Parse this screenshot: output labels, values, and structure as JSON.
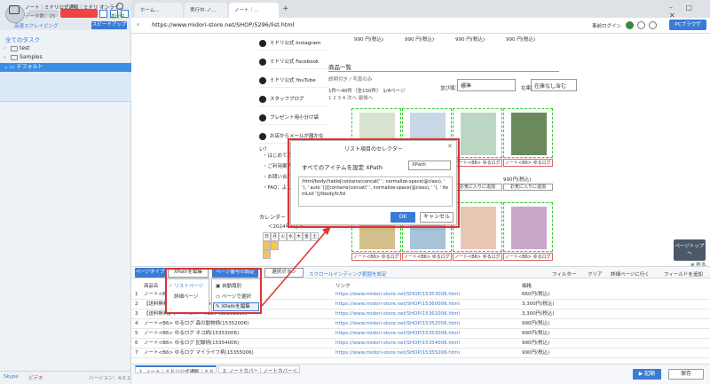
{
  "left": {
    "all_tasks": "全てのタスク",
    "tree": [
      "test",
      "Samples"
    ],
    "default_folder": "デフォルト",
    "task": {
      "title": "ノート｜ミドリ公式通販｜ミドリ オンライ...",
      "data": "データ数：25",
      "status": "運行中",
      "sub": "高速スクレイピング",
      "speedup": "スピードアップ"
    },
    "footer": {
      "skype": "Skype",
      "video": "ビデオ",
      "version": "バージョン：4.0.2"
    }
  },
  "browser": {
    "tabs": [
      "ホーム...",
      "実行中-ノ...",
      "ノート｜..."
    ],
    "tab_add": "+",
    "url": "https://www.midori-store.net/SHOP/5296/list.html",
    "login": "事前ログイン",
    "pc_browser": "PCブラウザ"
  },
  "page": {
    "prices_top": [
      "990 円(税込)",
      "990 円(税込)",
      "990 円(税込)",
      "990 円(税込)"
    ],
    "sidebar_links": [
      "ミドリ公式 Instagram",
      "ミドリ公式 Facebook",
      "ミドリ公式 YouTube",
      "スタッフブログ",
      "プレゼント用小分け袋",
      "お店からメールが届かない？"
    ],
    "sidebar_text": [
      "・はじめての",
      "・ご利用案内",
      "・お問い合わ",
      "・FAQ：よく"
    ],
    "list_title": "商品一覧",
    "list_desc": "説明付き / 写真のみ",
    "list_count": "1件～40件（全150件） 1/4ページ",
    "list_pages": "1 2 3 4 次へ 最後へ",
    "order_label": "並び順：",
    "order_value": "標準",
    "stock_label": "在庫：",
    "stock_value": "在庫なし含む",
    "products": [
      {
        "label": "ノート<B6> ゆるロ",
        "color": "#d8e4d0"
      },
      {
        "label": "ノート<B6> ゆるロ",
        "color": "#c8d8e6"
      },
      {
        "label": "ノート<B6> ゆるロ",
        "color": "#bcd6c4"
      },
      {
        "label": "ノート<B6> ゆるログ",
        "color": "#6a8a5c"
      },
      {
        "label": "ノート<B6> ゆるログ",
        "color": "#d4c08a"
      },
      {
        "label": "ノート<B6> ゆるログ",
        "color": "#a8c4d8"
      },
      {
        "label": "ノート<B6> ゆるログ",
        "color": "#e8c8b4"
      },
      {
        "label": "ノート<B6> ゆるログ",
        "color": "#c8a8c8"
      }
    ],
    "product_names_row1": [
      "",
      "",
      "ノート<B6> ゆるログ 森の動物柄(15352006)",
      "ノート<B6> ゆるログ 森の動物柄(15352006)"
    ],
    "fav_label": "お気に入りに追加",
    "row1_price": "990円(税込)",
    "calendar_title": "カレンダー",
    "calendar_month": "＜2024年5月＞",
    "calendar_days": [
      "日",
      "月",
      "火",
      "水",
      "木",
      "金",
      "土"
    ],
    "page_top": "ページトップへ",
    "shrink": "≡ 折る"
  },
  "modal": {
    "title": "リスト項目のセレクター",
    "label": "すべてのアイテムを設定 XPath",
    "select": "XPath",
    "xpath": "/html/body//table[contains(concat(' ', normalize-space(@class), ' '), ' auto ')]/[contains(concat(' ', normalize-space(@class), ' '), ' itemList ')]/tbody/tr/td",
    "ok": "OK",
    "cancel": "キャンセル"
  },
  "toolbar": {
    "page_type": "ページタイプ",
    "xpath_edit": "XPathを編集",
    "page_setting": "ページ番号の設定",
    "select_all": "選択ボタン",
    "scroll": "スクロールインディング範囲を設定",
    "filter": "フィルター",
    "clear": "クリア",
    "goto_detail": "詳細ページに行く",
    "add_field": "フィールドを追加"
  },
  "menu": {
    "items": [
      "リストページ",
      "詳細ページ"
    ],
    "sub_items": [
      "自動識別",
      "ページで選択",
      "XPathを編集"
    ]
  },
  "table": {
    "headers": [
      "商品名",
      "リンク",
      "価格"
    ],
    "rows": [
      {
        "num": "1",
        "name": "ノート<B6>...",
        "link": "https://www.midori-store.net/SHOP/15353006.html",
        "price": "660円(税込)"
      },
      {
        "num": "2",
        "name": "【送料無料】ノートカバー＜B6＞(15360006)",
        "link": "https://www.midori-store.net/SHOP/15360006.html",
        "price": "3,300円(税込)"
      },
      {
        "num": "3",
        "name": "【送料無料】ノートカバー＜B6＞(15361006)",
        "link": "https://www.midori-store.net/SHOP/15361006.html",
        "price": "3,300円(税込)"
      },
      {
        "num": "4",
        "name": "ノート<B6> ゆるログ 森の動物柄(15352006)",
        "link": "https://www.midori-store.net/SHOP/15352006.html",
        "price": "990円(税込)"
      },
      {
        "num": "5",
        "name": "ノート<B6> ゆるログ ネコ柄(15353006)",
        "link": "https://www.midori-store.net/SHOP/15353006.html",
        "price": "990円(税込)"
      },
      {
        "num": "6",
        "name": "ノート<B6> ゆるログ 記録柄(15354006)",
        "link": "https://www.midori-store.net/SHOP/15354006.html",
        "price": "990円(税込)"
      },
      {
        "num": "7",
        "name": "ノート<B6> ゆるログ マイライフ柄(15355006)",
        "link": "https://www.midori-store.net/SHOP/15355006.html",
        "price": "990円(税込)"
      }
    ]
  },
  "bottom": {
    "tabs": [
      "1. ノート｜ミドリ公式通販｜ミド...",
      "2. ノートカバー｜ノートカバー＜..."
    ],
    "launch": "起動",
    "save": "保存"
  },
  "colors": {
    "accent": "#3a7bd5",
    "highlight": "#d33"
  }
}
